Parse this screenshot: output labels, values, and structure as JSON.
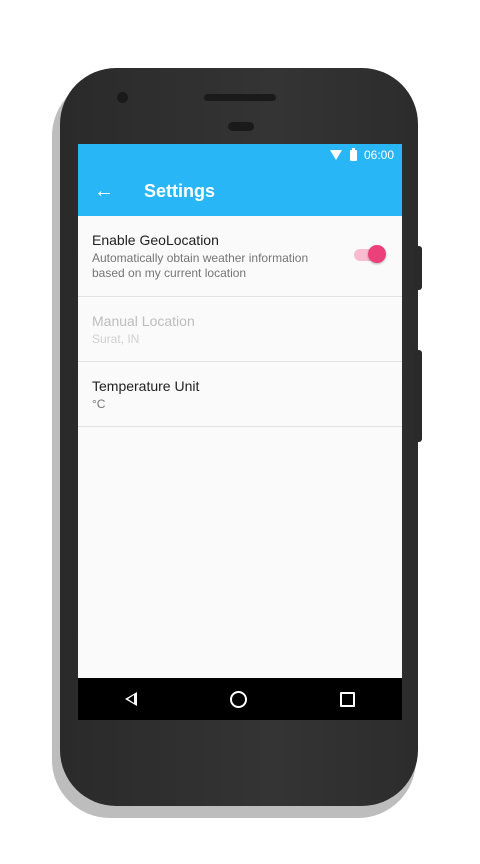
{
  "status_bar": {
    "time": "06:00",
    "wifi_icon": "wifi-icon",
    "battery_icon": "battery-icon"
  },
  "app_bar": {
    "back_icon": "arrow-back-icon",
    "title": "Settings",
    "color": "#29b6f6"
  },
  "preferences": [
    {
      "title": "Enable GeoLocation",
      "summary": "Automatically obtain weather information based on my current location",
      "toggle_on": true,
      "accent": "#ec407a"
    },
    {
      "title": "Manual Location",
      "summary": "Surat, IN",
      "enabled": false
    },
    {
      "title": "Temperature Unit",
      "summary": "°C"
    }
  ],
  "nav_bar": {
    "back_icon": "triangle-back-icon",
    "home_icon": "circle-home-icon",
    "recent_icon": "square-recents-icon"
  }
}
